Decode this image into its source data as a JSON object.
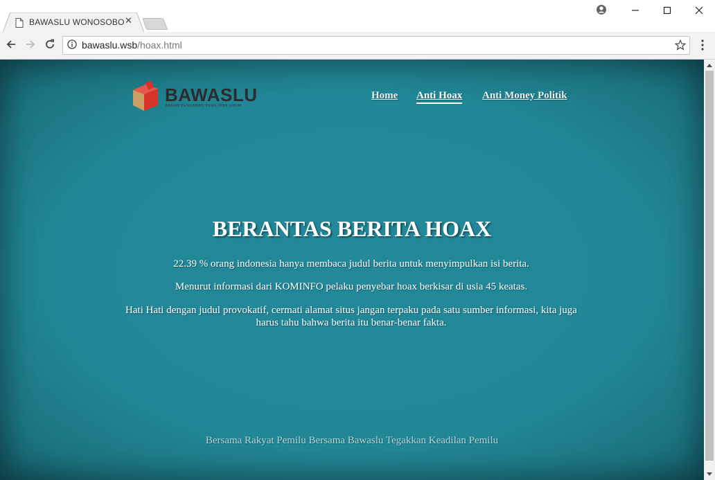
{
  "browser": {
    "tab_title": "BAWASLU WONOSOBO",
    "tab_close": "✕",
    "url_host": "bawaslu.wsb",
    "url_path": "/hoax.html",
    "icons": [
      "page-icon",
      "account-icon",
      "minimize-icon",
      "maximize-icon",
      "close-icon",
      "back-icon",
      "forward-icon",
      "reload-icon",
      "info-icon",
      "star-icon",
      "menu-icon"
    ]
  },
  "site": {
    "logo_text": "BAWASLU",
    "logo_subtext": "BADAN PENGAWAS PEMILIHAN UMUM",
    "nav": {
      "home": "Home",
      "anti_hoax": "Anti Hoax",
      "anti_money": "Anti Money Politik"
    },
    "headline": "BERANTAS BERITA HOAX",
    "paragraphs": [
      "22.39 % orang indonesia hanya membaca judul berita untuk menyimpulkan isi berita.",
      "Menurut informasi dari KOMINFO pelaku penyebar hoax berkisar di usia 45 keatas.",
      "Hati Hati dengan judul provokatif, cermati alamat situs jangan terpaku pada satu sumber informasi, kita juga harus tahu bahwa berita itu benar-benar fakta."
    ],
    "footer": "Bersama Rakyat Pemilu Bersama Bawaslu Tegakkan Keadilan Pemilu",
    "colors": {
      "background": "#218694",
      "logo_red": "#d8332a",
      "logo_tan": "#c9a167"
    }
  }
}
